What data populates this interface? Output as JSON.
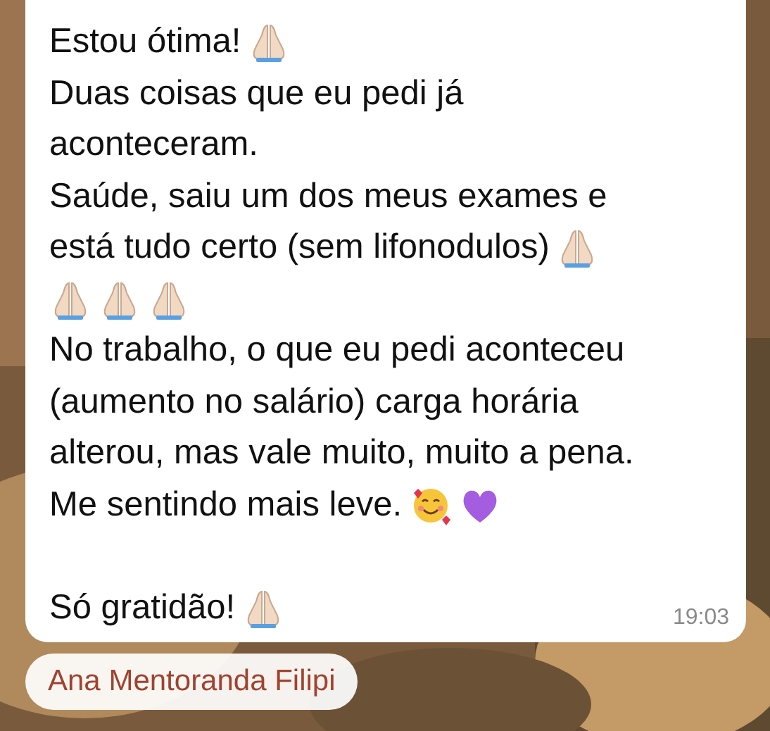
{
  "message": {
    "lines": [
      {
        "kind": "text",
        "text": "Estou ótima!",
        "icons": [
          {
            "kind": "pray"
          }
        ]
      },
      {
        "kind": "text",
        "text": "Duas coisas que eu pedi já"
      },
      {
        "kind": "text",
        "text": "aconteceram."
      },
      {
        "kind": "text",
        "text": "Saúde, saiu um dos meus exames e"
      },
      {
        "kind": "text",
        "text": "está tudo certo (sem lifonodulos)",
        "icons": [
          {
            "kind": "pray"
          }
        ]
      },
      {
        "kind": "emoji",
        "icons": [
          {
            "kind": "pray"
          },
          {
            "kind": "pray"
          },
          {
            "kind": "pray"
          }
        ]
      },
      {
        "kind": "text",
        "text": "No trabalho, o que eu pedi aconteceu"
      },
      {
        "kind": "text",
        "text": "(aumento no salário) carga horária"
      },
      {
        "kind": "text",
        "text": "alterou, mas vale muito, muito a pena."
      },
      {
        "kind": "text",
        "text": "Me sentindo mais leve.",
        "icons": [
          {
            "kind": "smiling-hearts"
          },
          {
            "kind": "purple-heart"
          }
        ]
      },
      {
        "kind": "blank"
      },
      {
        "kind": "text",
        "text": "Só gratidão!",
        "icons": [
          {
            "kind": "pray"
          }
        ]
      }
    ],
    "time": "19:03"
  },
  "sender": {
    "name": "Ana Mentoranda Filipi"
  }
}
